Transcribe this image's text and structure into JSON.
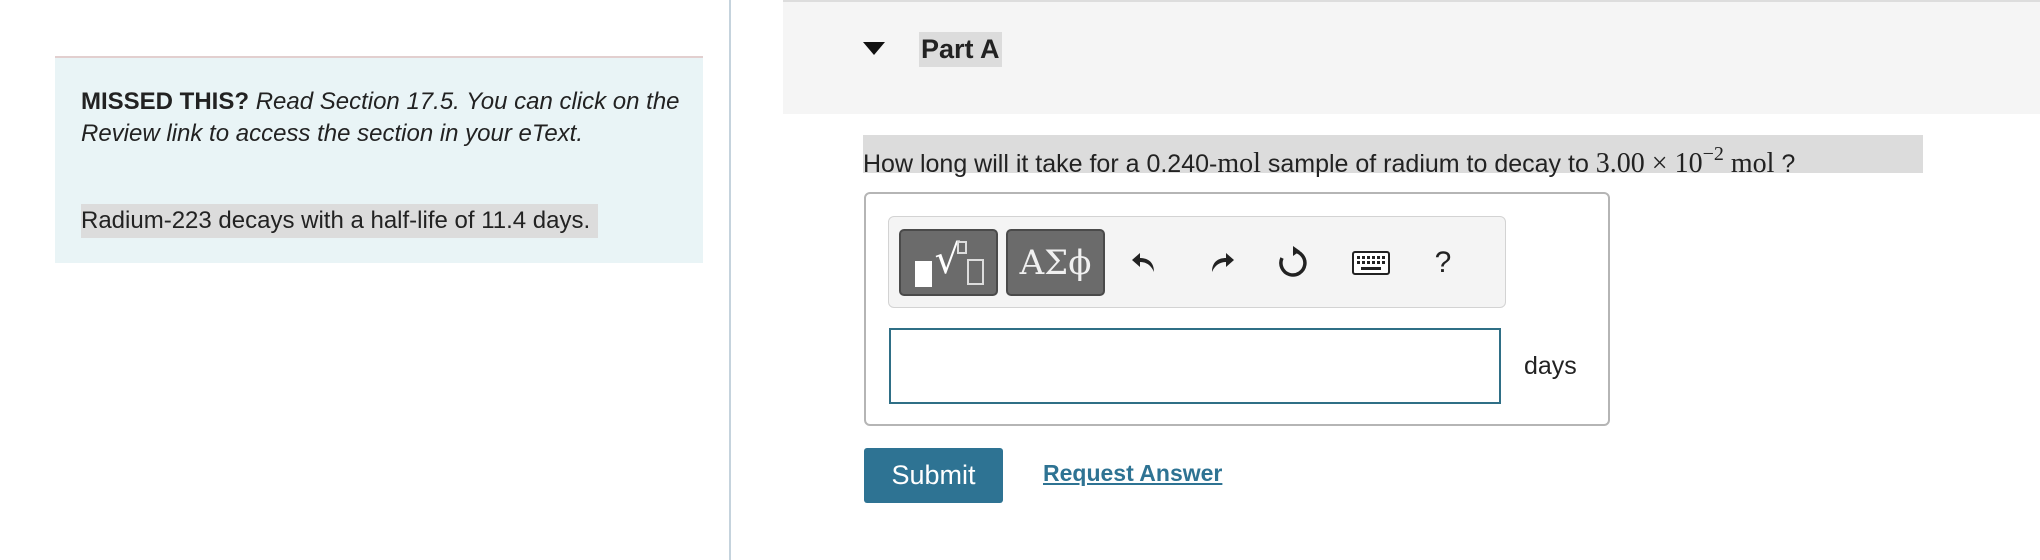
{
  "hint": {
    "missed_label": "MISSED THIS?",
    "missed_text": "Read Section 17.5. You can click on the Review link to access the section in your eText.",
    "fact": "Radium-223 decays with a half-life of 11.4 days."
  },
  "part": {
    "title": "Part A"
  },
  "question": {
    "prefix": "How long will it take for a 0.240-",
    "unit1": "mol",
    "middle": " sample of radium to decay to ",
    "value": "3.00 × 10",
    "exponent": "−2",
    "unit2": "mol",
    "suffix": " ?"
  },
  "toolbar": {
    "greek_label": "ΑΣϕ",
    "help_label": "?",
    "icons": [
      "templates-icon",
      "greek-letters-icon",
      "undo-icon",
      "redo-icon",
      "reset-icon",
      "keyboard-icon",
      "help-icon"
    ]
  },
  "answer": {
    "value": "",
    "unit": "days"
  },
  "actions": {
    "submit_label": "Submit",
    "request_label": "Request Answer"
  },
  "colors": {
    "accent": "#2e7393",
    "hint_bg": "#e9f4f6",
    "highlight": "#dcdcdc"
  }
}
